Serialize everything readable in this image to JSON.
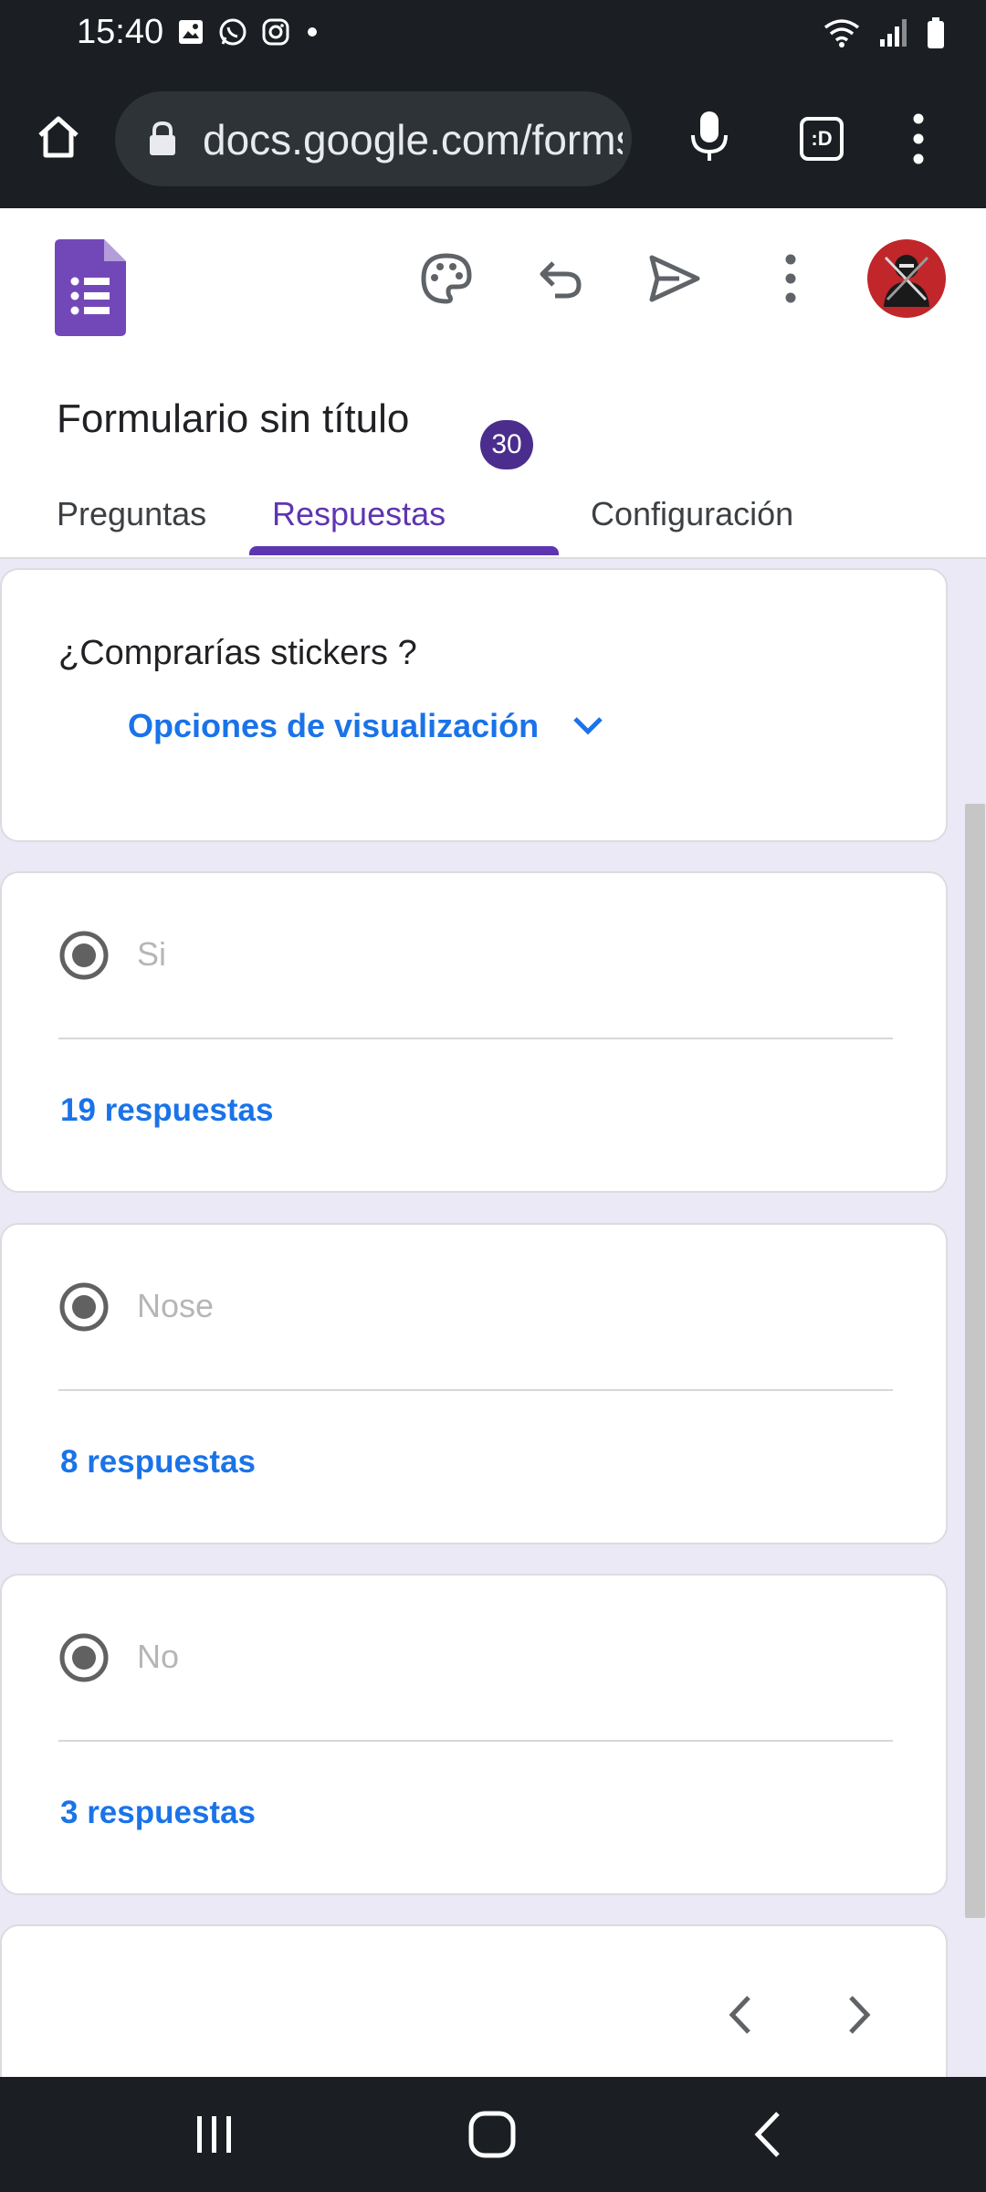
{
  "status_bar": {
    "time": "15:40",
    "left_icons": [
      "gallery-icon",
      "whatsapp-icon",
      "instagram-icon",
      "dot-icon"
    ],
    "right_icons": [
      "wifi-icon",
      "signal-icon",
      "battery-icon"
    ]
  },
  "browser": {
    "url": "docs.google.com/forms",
    "home_icon": "home-icon",
    "lock_icon": "lock-icon",
    "mic_icon": "microphone-icon",
    "tabs_icon_text": ":D",
    "menu_icon": "kebab-menu-icon"
  },
  "form": {
    "title": "Formulario sin título",
    "toolbar_icons": [
      "palette-icon",
      "undo-icon",
      "send-icon",
      "more-icon"
    ],
    "tabs": [
      {
        "label": "Preguntas"
      },
      {
        "label": "Respuestas",
        "badge": "30",
        "active": true
      },
      {
        "label": "Configuración"
      }
    ]
  },
  "question": {
    "title": "¿Comprarías stickers ?",
    "view_options_label": "Opciones de visualización"
  },
  "options": [
    {
      "label": "Si",
      "count_text": "19 respuestas"
    },
    {
      "label": "Nose",
      "count_text": "8 respuestas"
    },
    {
      "label": "No",
      "count_text": "3 respuestas"
    }
  ],
  "colors": {
    "accent": "#5e35b1",
    "link": "#1a73e8",
    "forms_icon": "#7248b9",
    "chrome_dark": "#1b1f23"
  }
}
